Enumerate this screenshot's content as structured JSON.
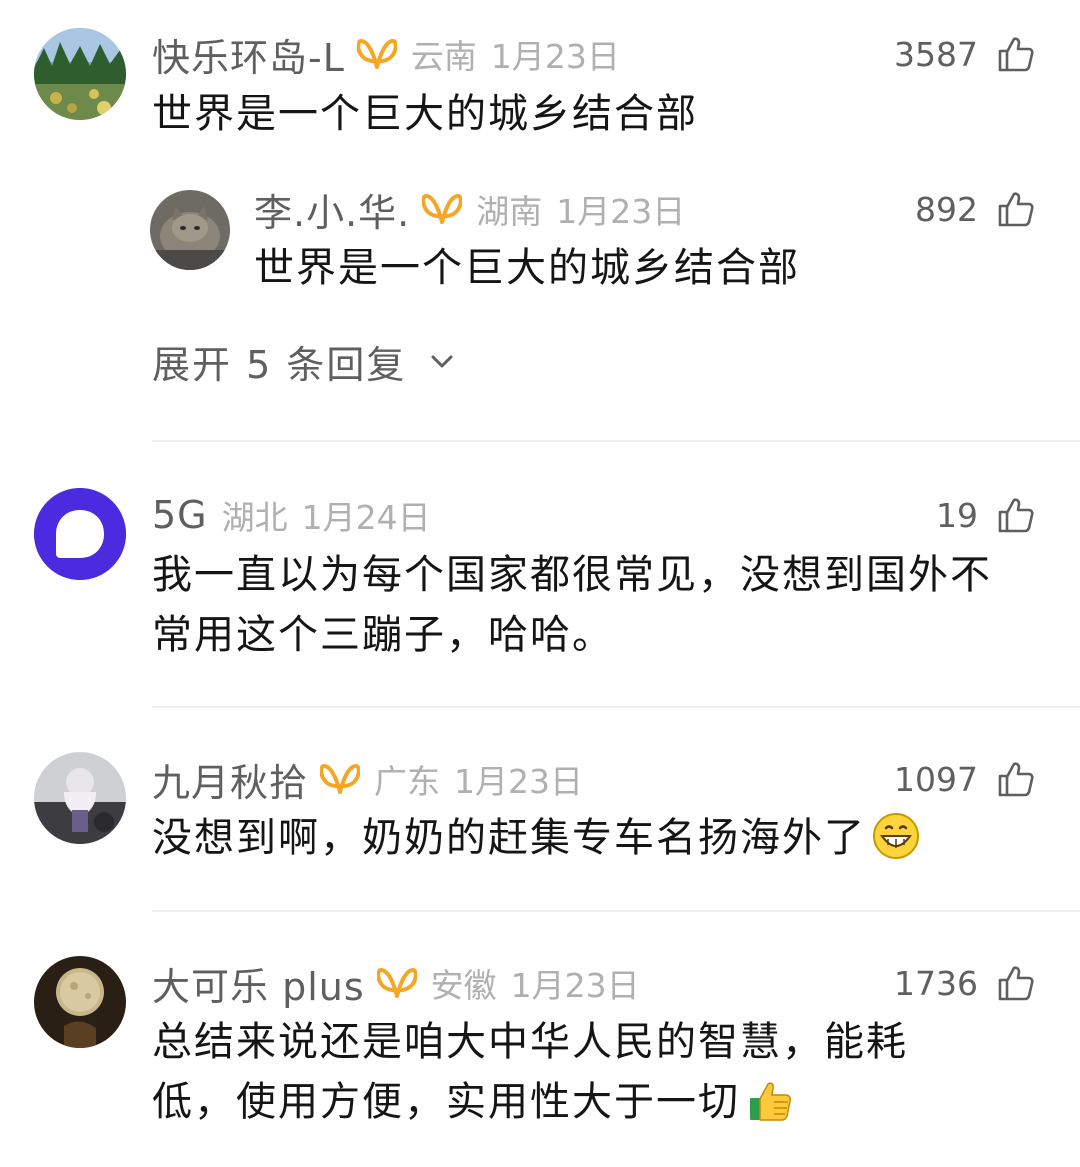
{
  "comments": [
    {
      "username": "快乐环岛-L",
      "location": "云南",
      "date": "1月23日",
      "likes": "3587",
      "text": "世界是一个巨大的城乡结合部",
      "reply": {
        "username": "李.小.华.",
        "location": "湖南",
        "date": "1月23日",
        "likes": "892",
        "text": "世界是一个巨大的城乡结合部"
      },
      "expand_label": "展开 5 条回复"
    },
    {
      "username": "5G",
      "location": "湖北",
      "date": "1月24日",
      "likes": "19",
      "text": "我一直以为每个国家都很常见，没想到国外不常用这个三蹦子，哈哈。"
    },
    {
      "username": "九月秋拾",
      "location": "广东",
      "date": "1月23日",
      "likes": "1097",
      "text": "没想到啊，奶奶的赶集专车名扬海外了"
    },
    {
      "username": "大可乐 plus",
      "location": "安徽",
      "date": "1月23日",
      "likes": "1736",
      "text": "总结来说还是咱大中华人民的智慧，能耗低，使用方便，实用性大于一切"
    }
  ],
  "icons": {
    "vip_badge": "vip-badge-icon",
    "like": "thumb-up-icon",
    "expand": "chevron-down-icon",
    "grin": "grinning-face-icon",
    "thumbs": "thumbs-up-emoji-icon"
  },
  "colors": {
    "vip_badge": "#f5a623",
    "meta_gray": "#b0b0b0",
    "name_gray": "#5f5f5f",
    "text": "#151515",
    "divider": "#efefef",
    "avatar_5g": "#4b2be0"
  }
}
